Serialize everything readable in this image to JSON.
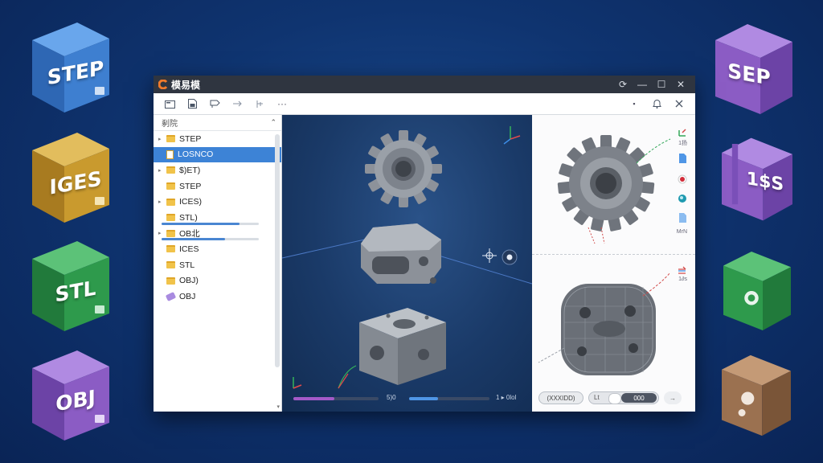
{
  "colors": {
    "blue_cube": "#3e7fd0",
    "yellow_cube": "#c99a2e",
    "green_cube": "#2e9a4c",
    "purple_cube": "#8b5cc4",
    "brown_cube": "#9b7150",
    "selection": "#3d83d6",
    "titlebar": "#2f3540"
  },
  "cubes_left": [
    {
      "label": "STEP",
      "color": "blue"
    },
    {
      "label": "IGES",
      "color": "yellow"
    },
    {
      "label": "STL",
      "color": "green"
    },
    {
      "label": "OBJ",
      "color": "purple"
    }
  ],
  "cubes_right": [
    {
      "label": "SEP",
      "color": "purple"
    },
    {
      "label": "1$S",
      "color": "purple"
    },
    {
      "label": "",
      "color": "green"
    },
    {
      "label": "",
      "color": "brown"
    }
  ],
  "window": {
    "title": "模易模",
    "buttons": [
      "⟳",
      "—",
      "☐",
      "✕"
    ]
  },
  "toolbar": {
    "icons": [
      "open-file-icon",
      "save-icon",
      "import-icon",
      "cut-icon",
      "measure-icon",
      "more-icon"
    ],
    "more_label": "···",
    "right": [
      "bell-icon",
      "close-icon"
    ]
  },
  "tree": {
    "header": "剢院",
    "items": [
      {
        "label": "STEP",
        "type": "folder",
        "expander": "▸"
      },
      {
        "label": "LOSNCO",
        "type": "file",
        "selected": true
      },
      {
        "label": "$)ET)",
        "type": "folder",
        "expander": "▸"
      },
      {
        "label": "STEP",
        "type": "folder"
      },
      {
        "label": "ICES)",
        "type": "folder",
        "expander": "▸"
      },
      {
        "label": "STL)",
        "type": "folder",
        "progress": 0.8
      },
      {
        "label": "OB北",
        "type": "folder",
        "expander": "▸",
        "progress": 0.65
      },
      {
        "label": "ICES",
        "type": "folder"
      },
      {
        "label": "STL",
        "type": "folder"
      },
      {
        "label": "OBJ)",
        "type": "folder"
      },
      {
        "label": "OBJ",
        "type": "tag"
      }
    ]
  },
  "viewport": {
    "bottom_text_left": "5)0",
    "bottom_text_right": "1 ▸ 0lol",
    "progress_left": 0.48,
    "progress_mid": 0.36
  },
  "right_panel": {
    "label_top": "1扬",
    "label_mid": "MrN",
    "label_lower": "1∂s",
    "bottom_pill_a": "(XXXIDD)",
    "bottom_pill_b_left": "Lt",
    "bottom_pill_b_dark": "000",
    "bottom_pill_c": "→"
  }
}
